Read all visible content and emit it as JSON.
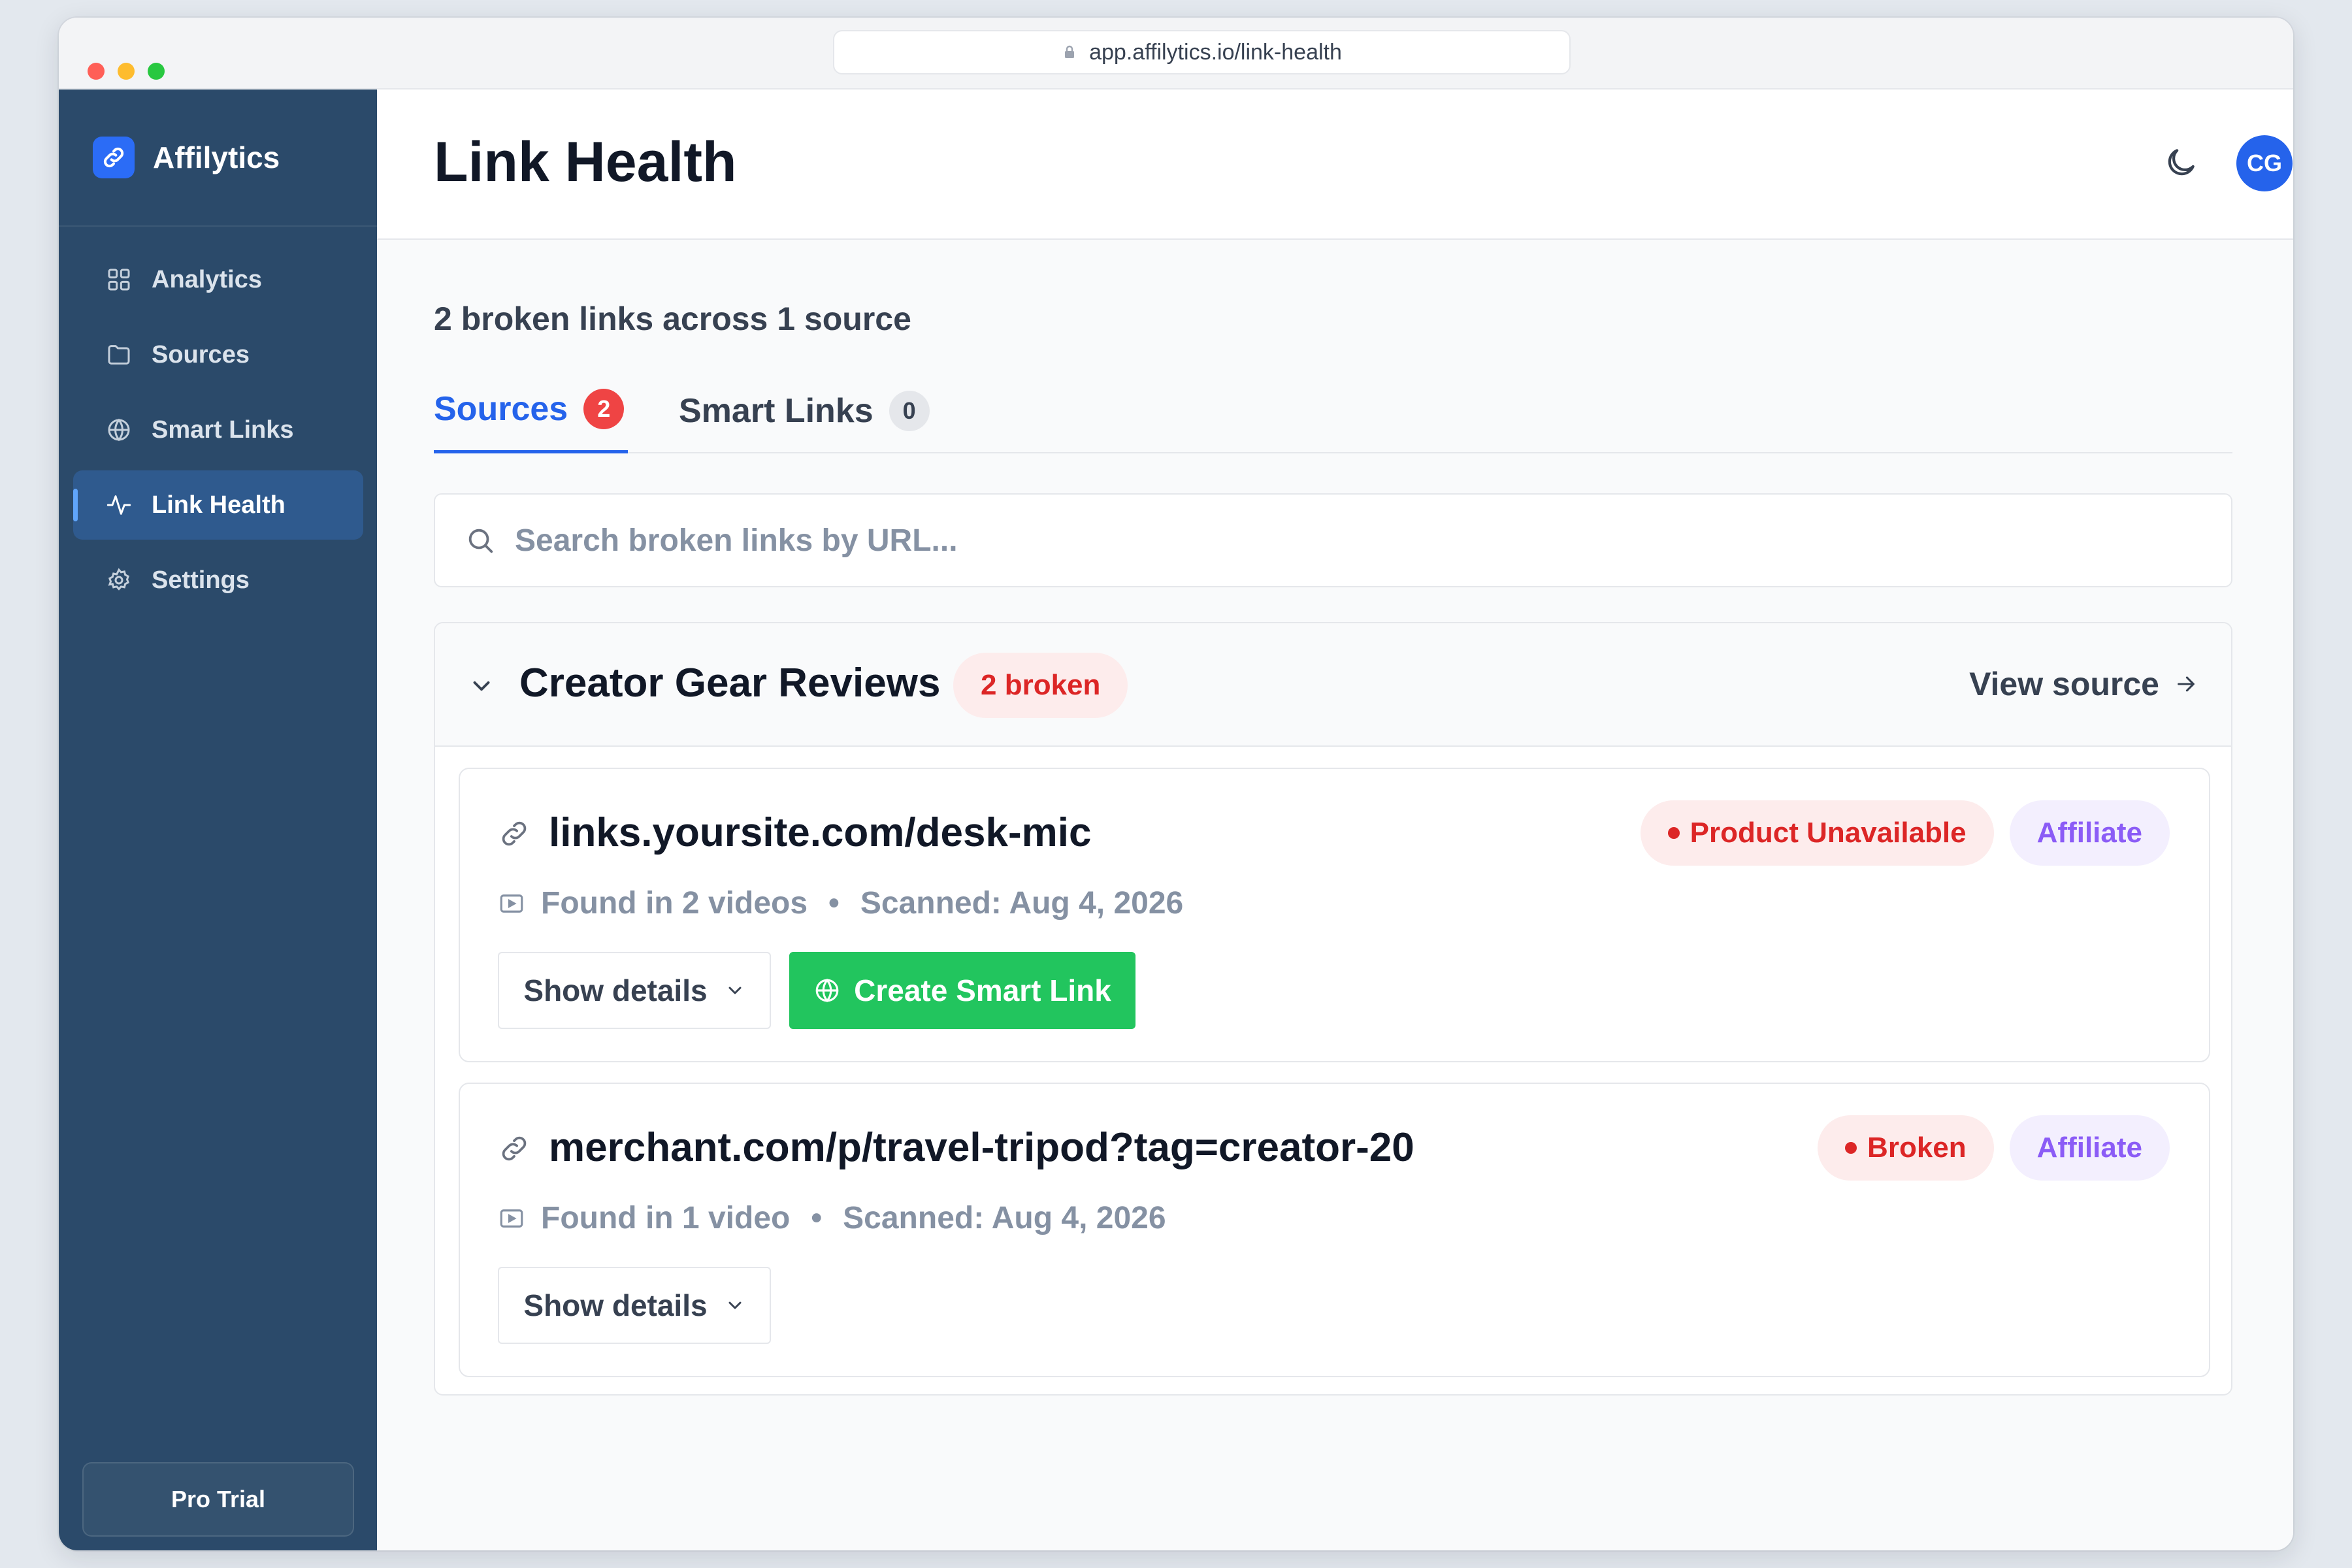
{
  "browser": {
    "url": "app.affilytics.io/link-health"
  },
  "sidebar": {
    "brand": "Affilytics",
    "items": [
      {
        "label": "Analytics",
        "icon": "grid-icon",
        "active": false
      },
      {
        "label": "Sources",
        "icon": "folder-icon",
        "active": false
      },
      {
        "label": "Smart Links",
        "icon": "globe-icon",
        "active": false
      },
      {
        "label": "Link Health",
        "icon": "activity-icon",
        "active": true
      },
      {
        "label": "Settings",
        "icon": "gear-icon",
        "active": false
      }
    ],
    "plan": "Pro Trial"
  },
  "header": {
    "title": "Link Health",
    "avatar_initials": "CG"
  },
  "summary": "2 broken links across 1 source",
  "tabs": [
    {
      "label": "Sources",
      "count": "2",
      "active": true
    },
    {
      "label": "Smart Links",
      "count": "0",
      "active": false
    }
  ],
  "search": {
    "placeholder": "Search broken links by URL...",
    "value": ""
  },
  "group": {
    "title": "Creator Gear Reviews",
    "badge": "2 broken",
    "view_source": "View source",
    "links": [
      {
        "url": "links.yoursite.com/desk-mic",
        "status": "Product Unavailable",
        "type": "Affiliate",
        "found": "Found in 2 videos",
        "scanned": "Scanned: Aug 4, 2026",
        "details_label": "Show details",
        "create_label": "Create Smart Link"
      },
      {
        "url": "merchant.com/p/travel-tripod?tag=creator-20",
        "status": "Broken",
        "type": "Affiliate",
        "found": "Found in 1 video",
        "scanned": "Scanned: Aug 4, 2026",
        "details_label": "Show details"
      }
    ]
  },
  "colors": {
    "sidebar": "#2b4a6a",
    "accent": "#2563eb",
    "error": "#dc2626",
    "success": "#22c55e",
    "affiliate": "#8b5cf6"
  }
}
